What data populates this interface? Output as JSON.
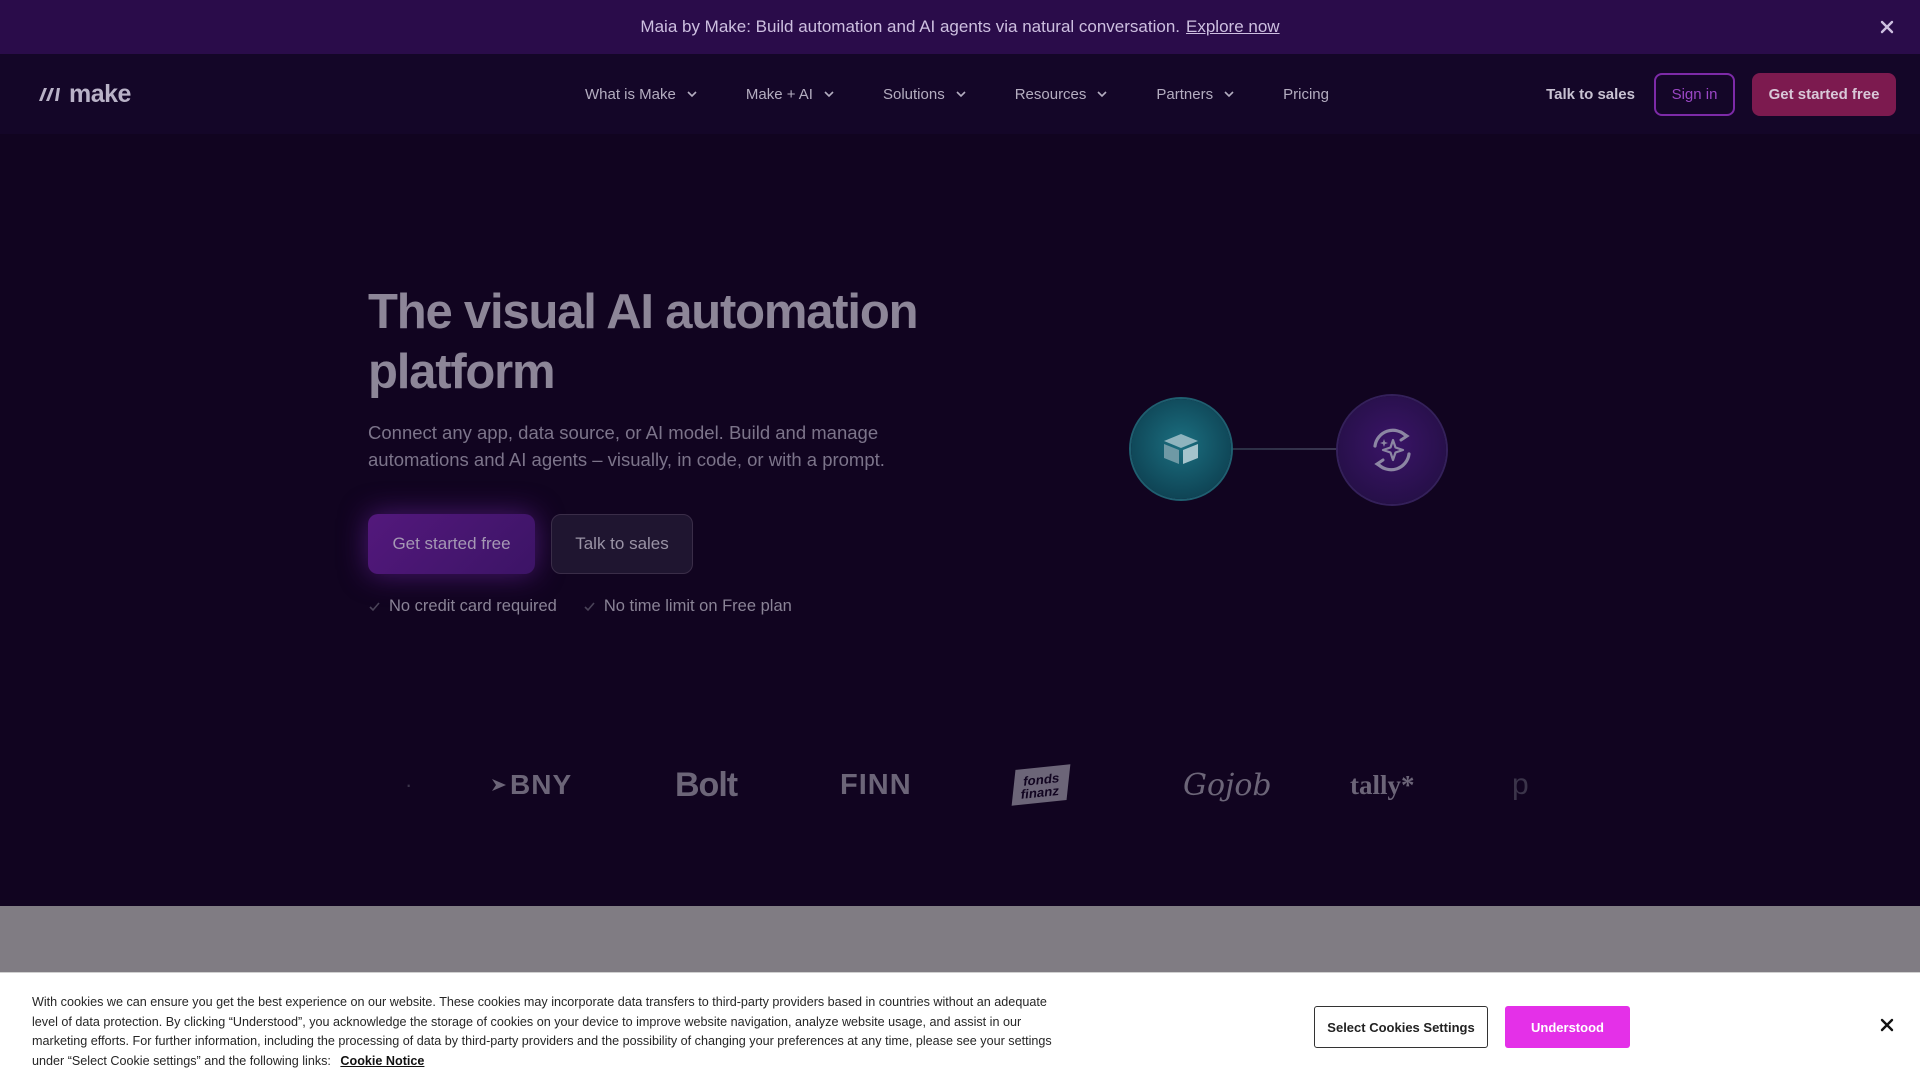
{
  "announcement": {
    "text": "Maia by Make: Build automation and AI agents via natural conversation.",
    "link": "Explore now"
  },
  "nav": {
    "logo_text": "make",
    "items": [
      {
        "label": "What is Make",
        "dropdown": true
      },
      {
        "label": "Make + AI",
        "dropdown": true
      },
      {
        "label": "Solutions",
        "dropdown": true
      },
      {
        "label": "Resources",
        "dropdown": true
      },
      {
        "label": "Partners",
        "dropdown": true
      },
      {
        "label": "Pricing",
        "dropdown": false
      }
    ],
    "talk_to_sales": "Talk to sales",
    "sign_in": "Sign in",
    "get_started": "Get started free"
  },
  "hero": {
    "title": "The visual AI automation platform",
    "subtitle": "Connect any app, data source, or AI model. Build and manage automations and AI agents – visually, in code, or with a prompt.",
    "cta_primary": "Get started free",
    "cta_secondary": "Talk to sales",
    "checks": [
      "No credit card required",
      "No time limit on Free plan"
    ]
  },
  "logos": {
    "bny": "BNY",
    "bolt": "Bolt",
    "finn": "FINN",
    "fonds_1": "fonds",
    "fonds_2": "finanz",
    "gojob": "Gojob",
    "tally": "tally*",
    "partial": "p"
  },
  "cookie": {
    "text": "With cookies we can ensure you get the best experience on our website. These cookies may incorporate data transfers to third-party providers based in countries without an adequate level of data protection. By clicking “Understood”, you acknowledge the storage of cookies on your device to improve website navigation, analyze website usage, and assist in our marketing efforts. For further information, including the processing of data by third-party providers and the possibility of changing your preferences at any time, please see your settings under “Select Cookie settings” and the following links:",
    "notice_link": "Cookie Notice",
    "settings_button": "Select Cookies Settings",
    "accept_button": "Understood"
  },
  "colors": {
    "background": "#110420",
    "announcement_bg": "#2a0c4a",
    "accent": "#7c1a4f",
    "cookie_accept": "#e430e8"
  },
  "icons": [
    "close-icon",
    "make-logo-icon",
    "chevron-down-icon",
    "check-icon",
    "box-icon",
    "sparkle-refresh-icon"
  ]
}
